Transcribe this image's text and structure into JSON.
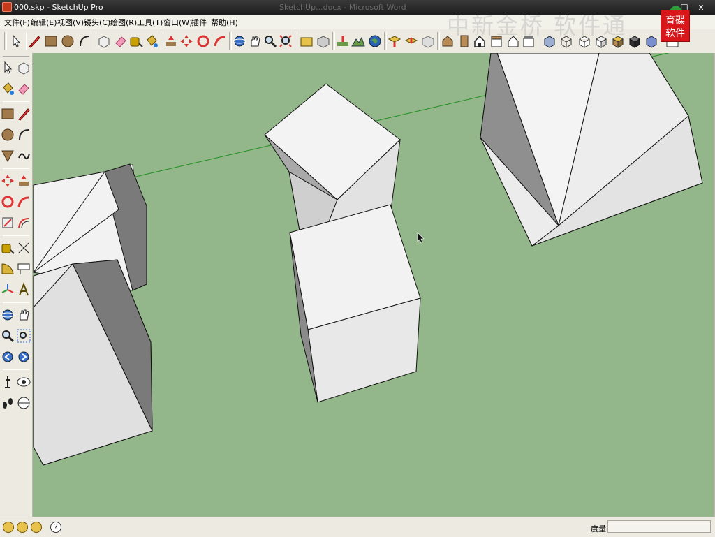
{
  "window": {
    "title": "000.skp - SketchUp Pro",
    "background_title": "SketchUp...docx - Microsoft Word",
    "buttons": {
      "minimize": "_",
      "restore": "□",
      "close": "x"
    }
  },
  "menu": [
    "文件(F)",
    "编辑(E)",
    "视图(V)",
    "镜头(C)",
    "绘图(R)",
    "工具(T)",
    "窗口(W)",
    "插件",
    "帮助(H)"
  ],
  "watermark": "中新金桥 软件通",
  "logo": {
    "line1": "育碟",
    "line2": "软件"
  },
  "toolbar_icons": [
    "select-icon",
    "pencil-icon",
    "rectangle-icon",
    "circle-icon",
    "arc-icon",
    "make-component-icon",
    "eraser-icon",
    "tape-measure-icon",
    "paint-bucket-icon",
    "push-pull-icon",
    "move-icon",
    "rotate-icon",
    "follow-me-icon",
    "orbit-icon",
    "pan-icon",
    "zoom-icon",
    "zoom-extents-icon",
    "get-models-icon",
    "share-model-icon",
    "add-location-icon",
    "toggle-terrain-icon",
    "google-earth-icon",
    "get-models-2-icon",
    "share-component-icon",
    "3d-warehouse-icon",
    "iso-view-icon",
    "top-view-icon",
    "front-view-icon",
    "right-view-icon",
    "back-view-icon",
    "left-view-icon",
    "xray-icon",
    "wireframe-icon",
    "hidden-line-icon",
    "shaded-icon",
    "shaded-textures-icon",
    "monochrome-icon",
    "section-icon"
  ],
  "left_toolbar_icons": [
    "select-icon",
    "make-component-icon",
    "paint-bucket-icon",
    "eraser-icon",
    "rectangle-icon",
    "line-icon",
    "circle-icon",
    "arc-icon",
    "polygon-icon",
    "freehand-icon",
    "move-icon",
    "push-pull-icon",
    "rotate-icon",
    "follow-me-icon",
    "scale-icon",
    "offset-icon",
    "tape-measure-icon",
    "dimension-icon",
    "protractor-icon",
    "text-icon",
    "axes-icon",
    "3d-text-icon",
    "orbit-icon",
    "pan-icon",
    "zoom-icon",
    "zoom-window-icon",
    "previous-view-icon",
    "next-view-icon",
    "position-camera-icon",
    "look-around-icon",
    "walk-icon",
    "section-plane-icon"
  ],
  "status": {
    "vcb_label": "度量",
    "vcb_value": "",
    "hint": ""
  },
  "colors": {
    "viewport_bg": "#93b68a",
    "face_light": "#f2f2f2",
    "face_mid": "#dcdcdc",
    "face_dark": "#7a7a7a",
    "axis_green": "#1f8f1f"
  }
}
